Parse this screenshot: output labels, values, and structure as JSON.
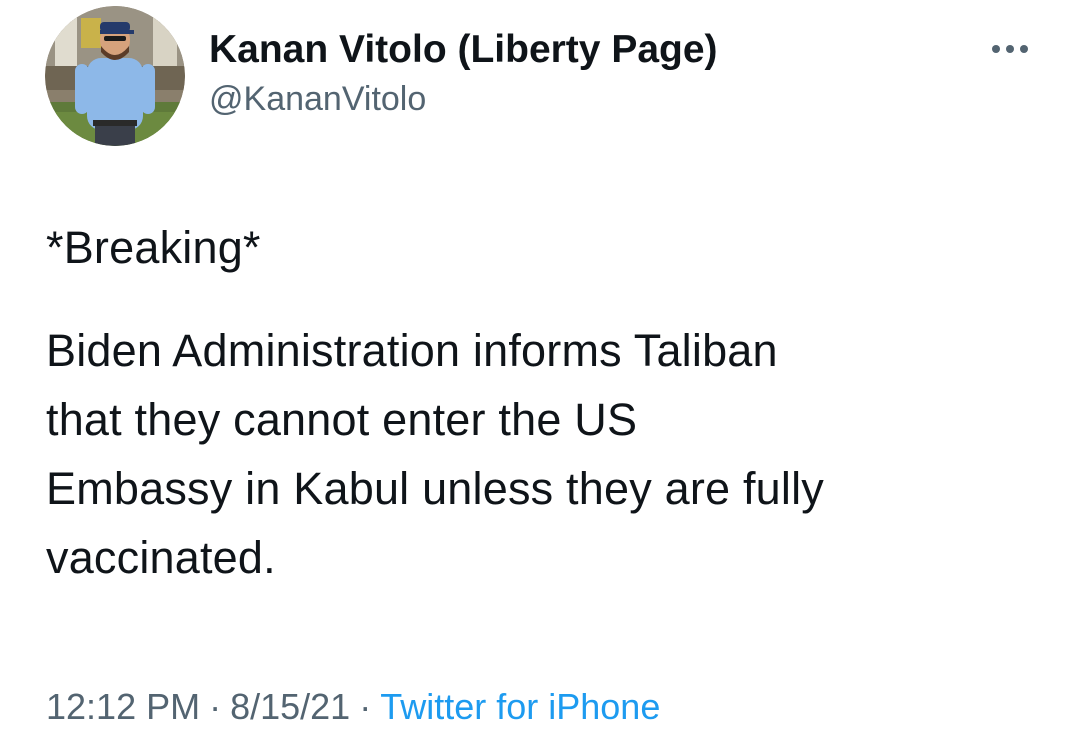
{
  "tweet": {
    "author": {
      "display_name": "Kanan Vitolo (Liberty Page)",
      "handle": "@KananVitolo"
    },
    "more_icon": "more-horizontal-icon",
    "body": {
      "paragraph_1": "*Breaking*",
      "line_1": "Biden Administration informs Taliban",
      "line_2": "that they cannot enter the US",
      "line_3": "Embassy in Kabul unless they are fully",
      "line_4": "vaccinated."
    },
    "meta": {
      "time": "12:12 PM",
      "separator": "·",
      "date": "8/15/21",
      "source": "Twitter for iPhone"
    }
  },
  "colors": {
    "text_primary": "#0f1419",
    "text_secondary": "#536471",
    "link": "#1d9bf0",
    "background": "#ffffff"
  }
}
